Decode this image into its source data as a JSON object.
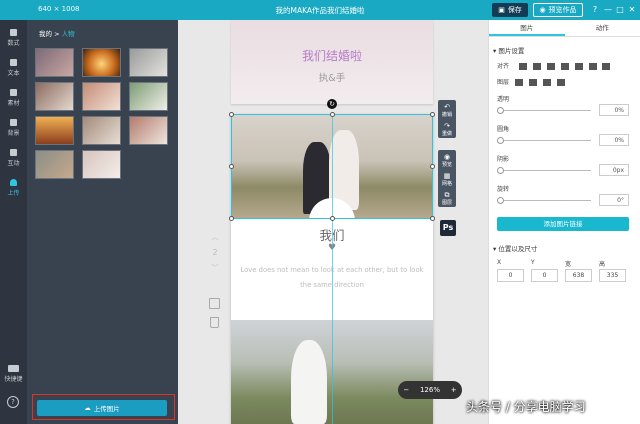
{
  "titlebar": {
    "canvas_size": "640 × 1008",
    "doc_title": "我的MAKA作品我们结婚啦",
    "save_label": "保存",
    "preview_label": "预览作品",
    "controls": [
      "?",
      "—",
      "□",
      "✕"
    ]
  },
  "leftnav": {
    "items": [
      {
        "label": "数式"
      },
      {
        "label": "文本"
      },
      {
        "label": "素材"
      },
      {
        "label": "背景"
      },
      {
        "label": "互动"
      },
      {
        "label": "上传"
      }
    ],
    "shortcut_label": "快捷键",
    "help_label": "?"
  },
  "panel": {
    "breadcrumb_root": "我的",
    "breadcrumb_sep": ">",
    "breadcrumb_current": "人物",
    "upload_label": "上传图片"
  },
  "canvas": {
    "prev_title": "我们结婚啦",
    "prev_subtitle": "执&手",
    "heading": "我们",
    "heart": "♥",
    "quote": "Love does not mean to look at each other, but to look the same direction",
    "page_number": "2",
    "zoom_minus": "−",
    "zoom_value": "126%",
    "zoom_plus": "+",
    "ps_label": "Ps",
    "rotate_glyph": "↻"
  },
  "sidetools": {
    "group1": [
      {
        "glyph": "↶",
        "label": "撤销"
      },
      {
        "glyph": "↷",
        "label": "重做"
      }
    ],
    "group2": [
      {
        "glyph": "◉",
        "label": "预览"
      },
      {
        "glyph": "▦",
        "label": "网格"
      },
      {
        "glyph": "⧉",
        "label": "图层"
      }
    ]
  },
  "rpanel": {
    "tab_image": "图片",
    "tab_anim": "动作",
    "section_image": "▾ 图片设置",
    "align_label": "对齐",
    "layer_label": "图层",
    "opacity_label": "透明",
    "opacity_value": "0%",
    "radius_label": "圆角",
    "radius_value": "0%",
    "shadow_label": "阴影",
    "shadow_value": "0px",
    "rotate_label": "旋转",
    "rotate_value": "0°",
    "add_link_label": "添加图片链接",
    "section_pos": "▾ 位置以及尺寸",
    "x_label": "X",
    "y_label": "Y",
    "w_label": "宽",
    "h_label": "高",
    "x_value": "0",
    "y_value": "0",
    "w_value": "638",
    "h_value": "335"
  },
  "watermark": "头条号 / 分享电脑学习"
}
